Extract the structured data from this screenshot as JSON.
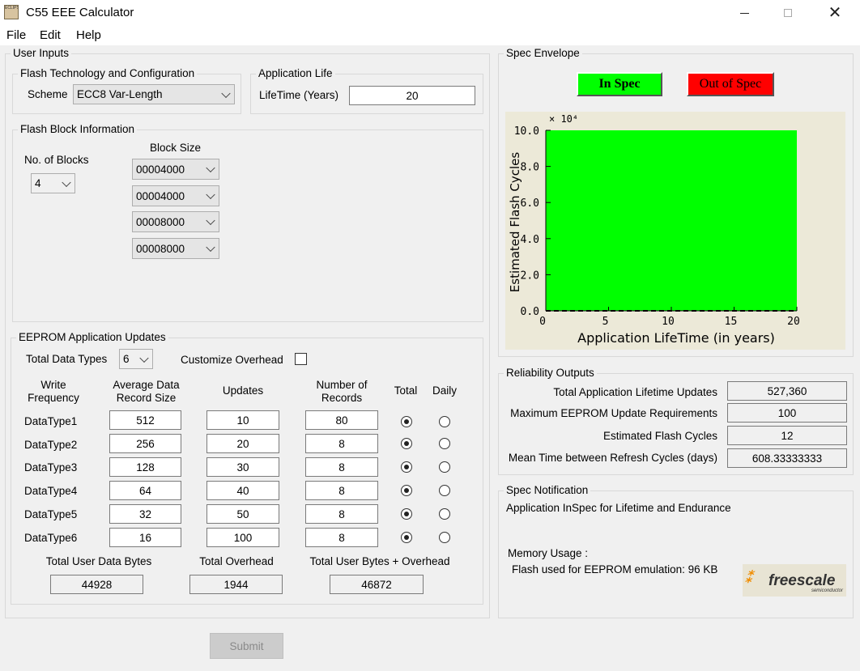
{
  "window": {
    "title": "C55 EEE Calculator",
    "icon_text": "ECLIPSE"
  },
  "menu": [
    "File",
    "Edit",
    "Help"
  ],
  "user_inputs": {
    "legend": "User Inputs",
    "flash_tech": {
      "legend": "Flash Technology and Configuration",
      "scheme_label": "Scheme",
      "scheme_value": "ECC8 Var-Length"
    },
    "app_life": {
      "legend": "Application Life",
      "lifetime_label": "LifeTime (Years)",
      "lifetime_value": "20"
    },
    "flash_block": {
      "legend": "Flash Block Information",
      "num_blocks_label": "No. of Blocks",
      "num_blocks_value": "4",
      "block_size_label": "Block Size",
      "block_sizes": [
        "00004000",
        "00004000",
        "00008000",
        "00008000"
      ]
    },
    "eeprom": {
      "legend": "EEPROM Application Updates",
      "total_types_label": "Total Data Types",
      "total_types_value": "6",
      "customize_label": "Customize Overhead",
      "headers": {
        "write_freq": "Write\nFrequency",
        "avg_size": "Average Data\nRecord Size",
        "updates": "Updates",
        "num_records": "Number of\nRecords",
        "total": "Total",
        "daily": "Daily"
      },
      "rows": [
        {
          "name": "DataType1",
          "size": "512",
          "updates": "10",
          "records": "80"
        },
        {
          "name": "DataType2",
          "size": "256",
          "updates": "20",
          "records": "8"
        },
        {
          "name": "DataType3",
          "size": "128",
          "updates": "30",
          "records": "8"
        },
        {
          "name": "DataType4",
          "size": "64",
          "updates": "40",
          "records": "8"
        },
        {
          "name": "DataType5",
          "size": "32",
          "updates": "50",
          "records": "8"
        },
        {
          "name": "DataType6",
          "size": "16",
          "updates": "100",
          "records": "8"
        }
      ],
      "totals": {
        "user_bytes_label": "Total User Data Bytes",
        "user_bytes": "44928",
        "overhead_label": "Total Overhead",
        "overhead": "1944",
        "combined_label": "Total User Bytes + Overhead",
        "combined": "46872"
      }
    }
  },
  "submit_label": "Submit",
  "spec_envelope": {
    "legend": "Spec Envelope",
    "in_spec": "In Spec",
    "out_of_spec": "Out of Spec",
    "colors": {
      "in": "#00ff00",
      "out": "#ff0000",
      "plot_bg": "#ece9d8"
    }
  },
  "chart_data": {
    "type": "area",
    "multiplier": "× 10⁴",
    "ylabel": "Estimated Flash Cycles",
    "xlabel": "Application LifeTime (in years)",
    "xlim": [
      0,
      20
    ],
    "ylim": [
      0,
      100000
    ],
    "x_ticks": [
      "0",
      "5",
      "10",
      "15",
      "20"
    ],
    "y_ticks": [
      "0.0",
      "2.0",
      "4.0",
      "6.0",
      "8.0",
      "10.0"
    ],
    "series": [
      {
        "x": [
          0,
          20
        ],
        "y": [
          100000,
          100000
        ],
        "color": "#00ff00"
      }
    ],
    "reference_line": {
      "x": [
        0,
        20
      ],
      "y": [
        12,
        12
      ],
      "style": "dashed"
    }
  },
  "reliability": {
    "legend": "Reliability Outputs",
    "rows": [
      {
        "label": "Total Application Lifetime Updates",
        "value": "527,360"
      },
      {
        "label": "Maximum EEPROM Update Requirements",
        "value": "100"
      },
      {
        "label": "Estimated Flash Cycles",
        "value": "12"
      },
      {
        "label": "Mean Time between Refresh Cycles (days)",
        "value": "608.33333333"
      }
    ]
  },
  "notification": {
    "legend": "Spec Notification",
    "message": "Application InSpec for Lifetime and Endurance",
    "memory_label": "Memory Usage :",
    "flash_used": "Flash used for EEPROM emulation: 96 KB",
    "logo_text": "freescale",
    "logo_sub": "semiconductor"
  }
}
